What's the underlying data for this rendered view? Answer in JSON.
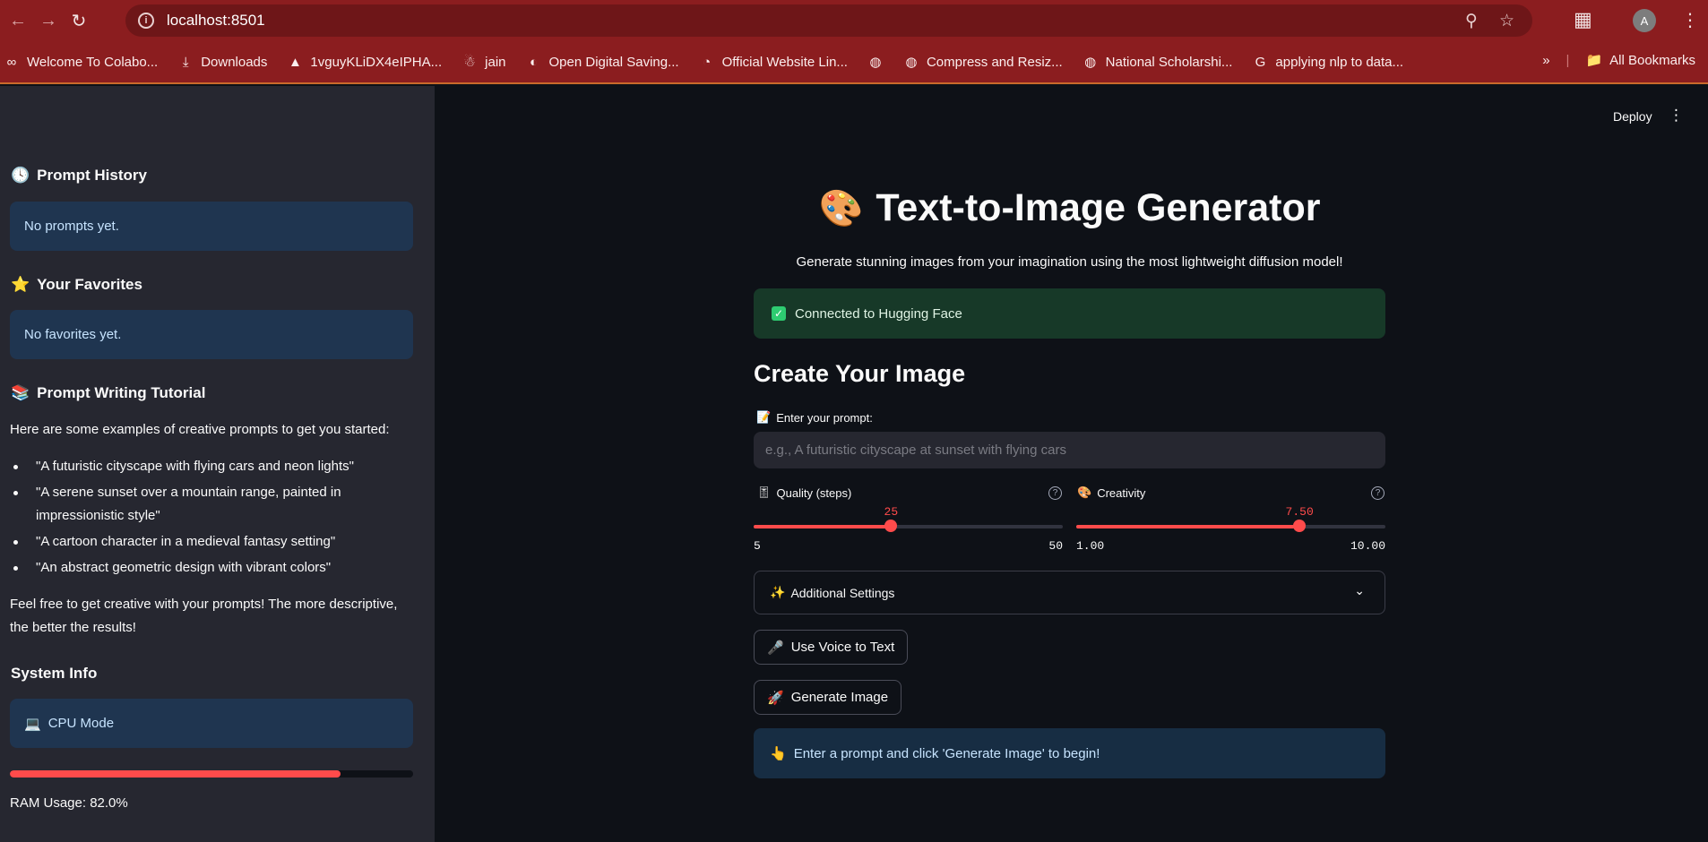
{
  "browser": {
    "url": "localhost:8501",
    "bookmarks": [
      {
        "icon": "colab-icon",
        "glyph": "∞",
        "label": "Welcome To Colabo..."
      },
      {
        "icon": "download-icon",
        "glyph": "⤓",
        "label": "Downloads"
      },
      {
        "icon": "drive-icon",
        "glyph": "▲",
        "label": "1vguyKLiDX4eIPHA..."
      },
      {
        "icon": "robot-icon",
        "glyph": "☃",
        "label": "jain"
      },
      {
        "icon": "bank-icon",
        "glyph": "◐",
        "label": "Open Digital Saving..."
      },
      {
        "icon": "site-icon",
        "glyph": "◔",
        "label": "Official Website Lin..."
      },
      {
        "icon": "globe-icon",
        "glyph": "◍",
        "label": ""
      },
      {
        "icon": "globe-icon",
        "glyph": "◍",
        "label": "Compress and Resiz..."
      },
      {
        "icon": "globe-icon",
        "glyph": "◍",
        "label": "National Scholarshi..."
      },
      {
        "icon": "google-icon",
        "glyph": "G",
        "label": "applying nlp to data..."
      }
    ],
    "all_bookmarks": "All Bookmarks",
    "profile_initial": "A"
  },
  "sidebar": {
    "history_title": "Prompt History",
    "history_empty": "No prompts yet.",
    "favorites_title": "Your Favorites",
    "favorites_empty": "No favorites yet.",
    "tutorial_title": "Prompt Writing Tutorial",
    "tutorial_intro": "Here are some examples of creative prompts to get you started:",
    "examples": [
      "\"A futuristic cityscape with flying cars and neon lights\"",
      "\"A serene sunset over a mountain range, painted in impressionistic style\"",
      "\"A cartoon character in a medieval fantasy setting\"",
      "\"An abstract geometric design with vibrant colors\""
    ],
    "tutorial_outro": "Feel free to get creative with your prompts! The more descriptive, the better the results!",
    "system_title": "System Info",
    "cpu_mode": "CPU Mode",
    "ram_usage_fraction": 0.82,
    "ram_label": "RAM Usage: 82.0%"
  },
  "header": {
    "deploy": "Deploy"
  },
  "main": {
    "title": "Text-to-Image Generator",
    "subtitle": "Generate stunning images from your imagination using the most lightweight diffusion model!",
    "connected": "Connected to Hugging Face",
    "create_heading": "Create Your Image",
    "prompt_label": "Enter your prompt:",
    "prompt_placeholder": "e.g., A futuristic cityscape at sunset with flying cars",
    "quality": {
      "label": "Quality (steps)",
      "value": "25",
      "min": "5",
      "max": "50",
      "num_value": 25,
      "num_min": 5,
      "num_max": 50
    },
    "creativity": {
      "label": "Creativity",
      "value": "7.50",
      "min": "1.00",
      "max": "10.00",
      "num_value": 7.5,
      "num_min": 1,
      "num_max": 10
    },
    "additional_settings": "Additional Settings",
    "voice_button": "Use Voice to Text",
    "generate_button": "Generate Image",
    "info_message": "Enter a prompt and click 'Generate Image' to begin!"
  },
  "colors": {
    "accent": "#ff4b4b",
    "sidebar_bg": "#262730",
    "main_bg": "#0e1117",
    "chrome": "#8b1d1f"
  }
}
